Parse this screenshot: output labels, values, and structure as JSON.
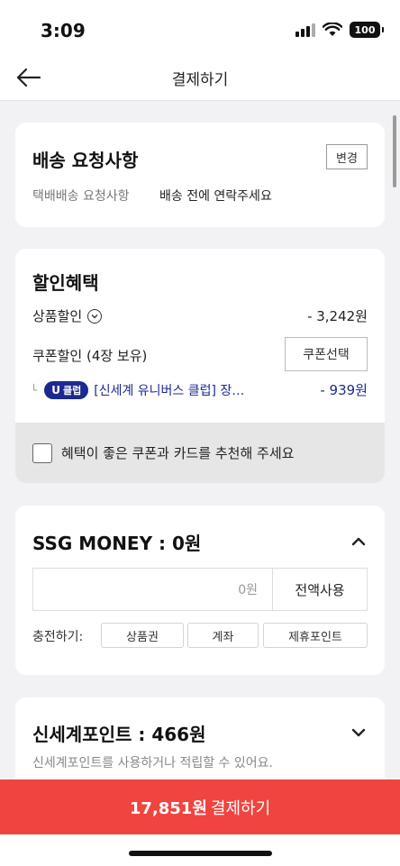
{
  "status": {
    "time": "3:09",
    "battery": "100"
  },
  "nav": {
    "title": "결제하기"
  },
  "shipping": {
    "title": "배송 요청사항",
    "change_label": "변경",
    "method_label": "택배배송 요청사항",
    "request_value": "배송 전에 연락주세요"
  },
  "discount": {
    "title": "할인혜택",
    "product_label": "상품할인",
    "product_amount": "- 3,242원",
    "coupon_label": "쿠폰할인 (4장 보유)",
    "coupon_button": "쿠폰선택",
    "coupon_corner": "└",
    "uclub_u": "U",
    "uclub_text": "클럽",
    "coupon_name": "[신세계 유니버스 클럽] 장…",
    "coupon_amount": "- 939원",
    "recommend_text": "혜택이 좋은 쿠폰과 카드를 추천해 주세요"
  },
  "money": {
    "title": "SSG MONEY : 0원",
    "input_value": "0원",
    "use_all": "전액사용",
    "charge_label": "충전하기:",
    "charge_options": [
      "상품권",
      "계좌",
      "제휴포인트"
    ]
  },
  "points": {
    "title": "신세계포인트 : 466원",
    "description": "신세계포인트를 사용하거나 적립할 수 있어요."
  },
  "pay": {
    "amount": "17,851원",
    "label": "결제하기"
  },
  "colors": {
    "pay_bar": "#f0443f",
    "uclub_badge": "#1c2a8f"
  }
}
